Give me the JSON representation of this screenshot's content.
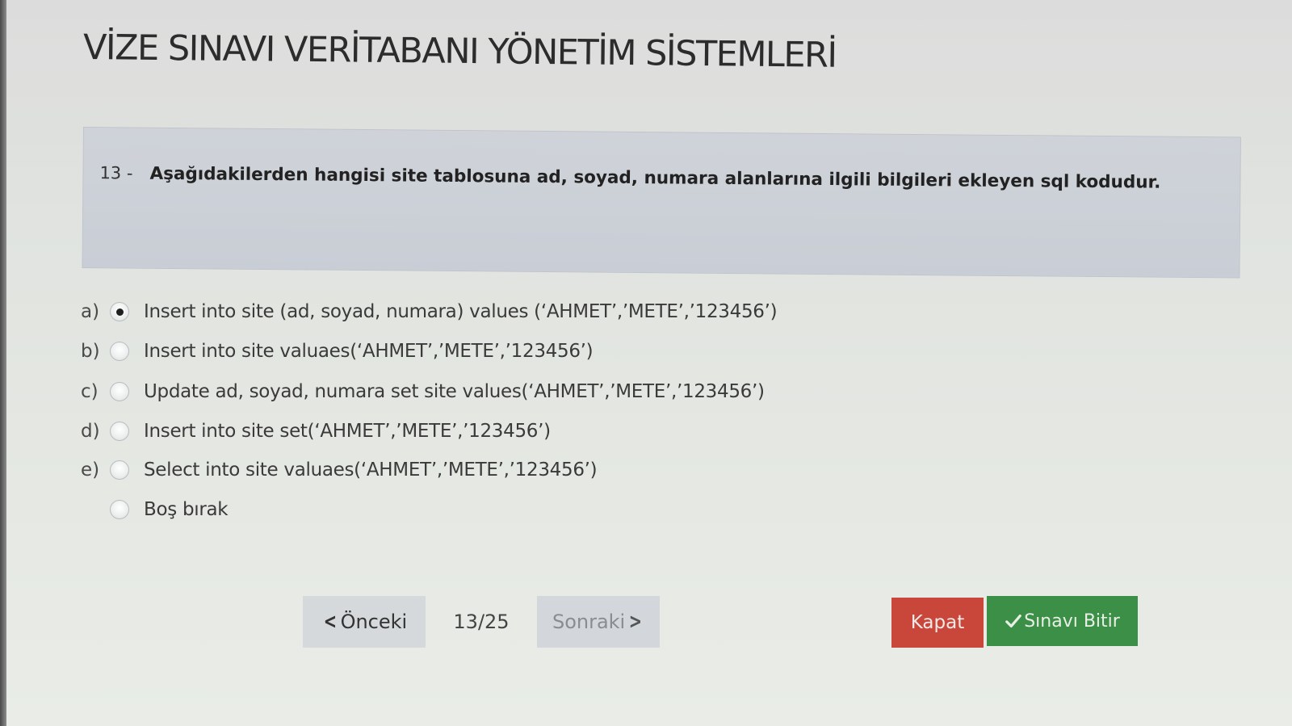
{
  "exam": {
    "title": "VİZE SINAVI VERİTABANI YÖNETİM SİSTEMLERİ"
  },
  "question": {
    "number": "13 -",
    "text": "Aşağıdakilerden hangisi site tablosuna ad, soyad, numara alanlarına ilgili bilgileri ekleyen sql kodudur."
  },
  "options": [
    {
      "letter": "a)",
      "text": "Insert into site (ad, soyad, numara) values (‘AHMET’,’METE’,’123456’)",
      "selected": true
    },
    {
      "letter": "b)",
      "text": "Insert into site valuaes(‘AHMET’,’METE’,’123456’)",
      "selected": false
    },
    {
      "letter": "c)",
      "text": "Update ad, soyad, numara set site values(‘AHMET’,’METE’,’123456’)",
      "selected": false
    },
    {
      "letter": "d)",
      "text": "Insert into site set(‘AHMET’,’METE’,’123456’)",
      "selected": false
    },
    {
      "letter": "e)",
      "text": "Select into site valuaes(‘AHMET’,’METE’,’123456’)",
      "selected": false
    },
    {
      "letter": "",
      "text": "Boş bırak",
      "selected": false
    }
  ],
  "pager": {
    "prev_label": "Önceki",
    "indicator": "13/25",
    "next_label": "Sonraki",
    "prev_icon": "chevron-left-icon",
    "next_icon": "chevron-right-icon"
  },
  "actions": {
    "close_label": "Kapat",
    "finish_label": "Sınavı Bitir",
    "finish_icon": "check-icon"
  },
  "colors": {
    "close_button": "#c9463b",
    "finish_button": "#3b8f46",
    "question_panel": "#cbd0d8"
  }
}
